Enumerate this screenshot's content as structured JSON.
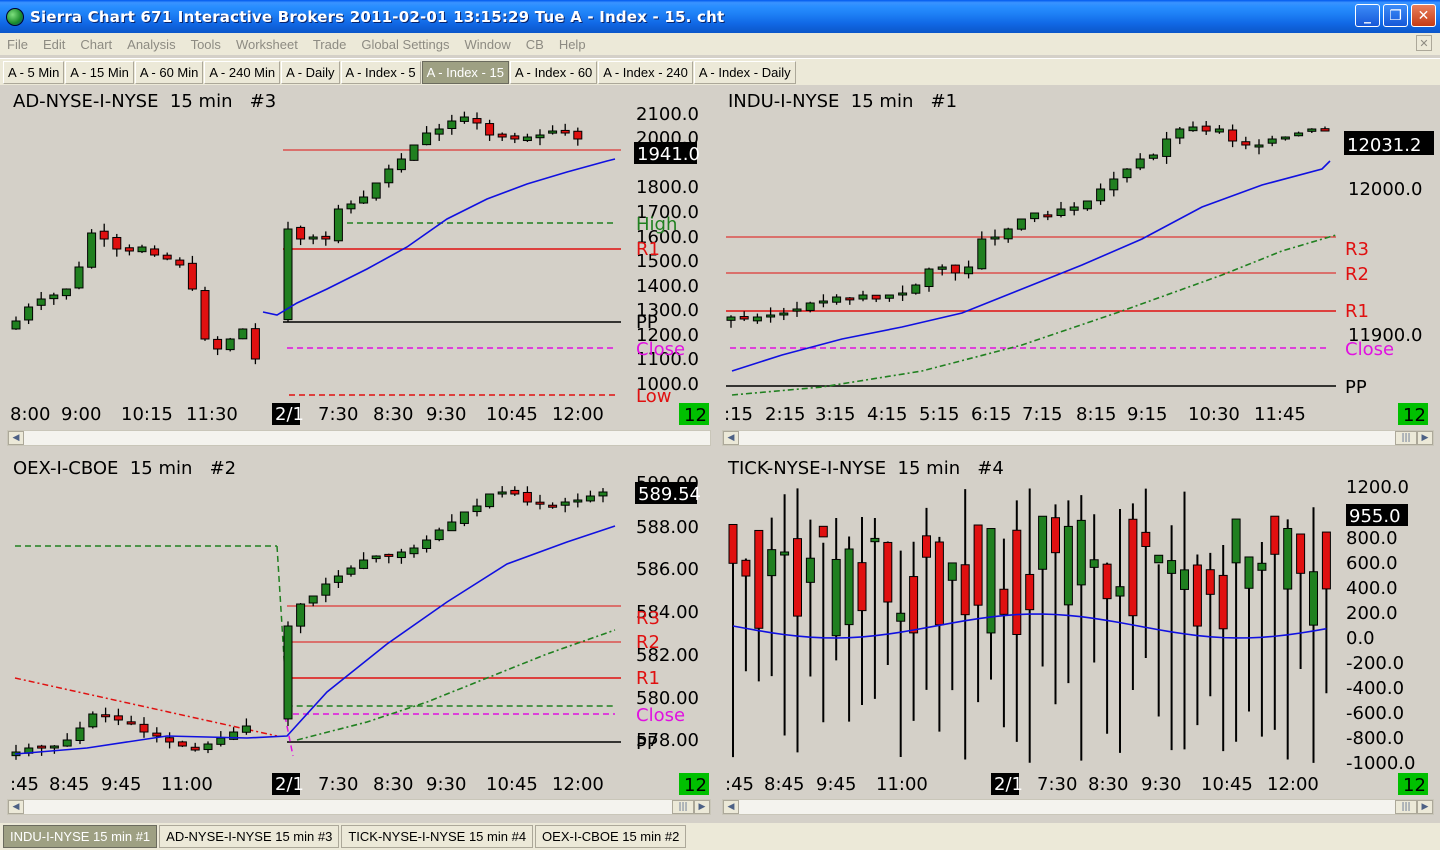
{
  "window": {
    "title": "Sierra Chart 671 Interactive Brokers 2011-02-01   13:15:29  Tue    A - Index - 15. cht"
  },
  "menu": [
    "File",
    "Edit",
    "Chart",
    "Analysis",
    "Tools",
    "Worksheet",
    "Trade",
    "Global Settings",
    "Window",
    "CB",
    "Help"
  ],
  "chart_tabs": [
    "A - 5 Min",
    "A - 15 Min",
    "A - 60 Min",
    "A - 240 Min",
    "A - Daily",
    "A - Index - 5",
    "A - Index - 15",
    "A - Index - 60",
    "A - Index - 240",
    "A - Index - Daily"
  ],
  "active_chart_tab": "A - Index - 15",
  "bottom_tabs": [
    "INDU-I-NYSE  15 min  #1",
    "AD-NYSE-I-NYSE  15 min  #3",
    "TICK-NYSE-I-NYSE  15 min  #4",
    "OEX-I-CBOE  15 min  #2"
  ],
  "active_bottom_tab": "INDU-I-NYSE  15 min  #1",
  "colors": {
    "up": "#208020",
    "down": "#e01010",
    "ma": "#1010e0",
    "pivot": "#000000",
    "r": "#e01010",
    "high": "#208020",
    "close": "#e010e0",
    "bg": "#d4d0c8",
    "badge": "#00c000"
  },
  "charts": [
    {
      "id": "ad",
      "title": "AD-NYSE-I-NYSE  15 min   #3",
      "bar_count_badge": "12",
      "price_badge": "1941.0",
      "y_ticks": [
        "2100.0",
        "2000.0",
        "1800.0",
        "1700.0",
        "1600.0",
        "1500.0",
        "1400.0",
        "1300.0",
        "1200.0",
        "1100.0",
        "1000.0"
      ],
      "x_labels": [
        "8:00",
        "9:00",
        "10:15",
        "11:30",
        "2/1",
        "7:30",
        "8:30",
        "9:30",
        "10:45",
        "12:00"
      ],
      "level_labels": [
        "High",
        "R1",
        "PP",
        "Close",
        "Low"
      ]
    },
    {
      "id": "indu",
      "title": "INDU-I-NYSE  15 min   #1",
      "bar_count_badge": "12",
      "price_badge": "12031.2",
      "y_ticks": [
        "12000.0",
        "11900.0"
      ],
      "x_labels": [
        ":15",
        "2:15",
        "3:15",
        "4:15",
        "5:15",
        "6:15",
        "7:15",
        "8:15",
        "9:15",
        "10:30",
        "11:45"
      ],
      "level_labels": [
        "R3",
        "R2",
        "R1",
        "Close",
        "PP"
      ]
    },
    {
      "id": "oex",
      "title": "OEX-I-CBOE  15 min   #2",
      "bar_count_badge": "12",
      "price_badge": "589.54",
      "y_ticks": [
        "590.00",
        "588.00",
        "586.00",
        "584.00",
        "582.00",
        "580.00",
        "578.00"
      ],
      "x_labels": [
        ":45",
        "8:45",
        "9:45",
        "11:00",
        "2/1",
        "7:30",
        "8:30",
        "9:30",
        "10:45",
        "12:00"
      ],
      "level_labels": [
        "R3",
        "R2",
        "R1",
        "Close",
        "PP"
      ]
    },
    {
      "id": "tick",
      "title": "TICK-NYSE-I-NYSE  15 min   #4",
      "bar_count_badge": "12",
      "price_badge": "955.0",
      "y_ticks": [
        "1200.0",
        "1000.0",
        "800.0",
        "600.0",
        "400.0",
        "200.0",
        "0.0",
        "-200.0",
        "-400.0",
        "-600.0",
        "-800.0",
        "-1000.0"
      ],
      "x_labels": [
        ":45",
        "8:45",
        "9:45",
        "11:00",
        "2/1",
        "7:30",
        "8:30",
        "9:30",
        "10:45",
        "12:00"
      ],
      "level_labels": []
    }
  ]
}
